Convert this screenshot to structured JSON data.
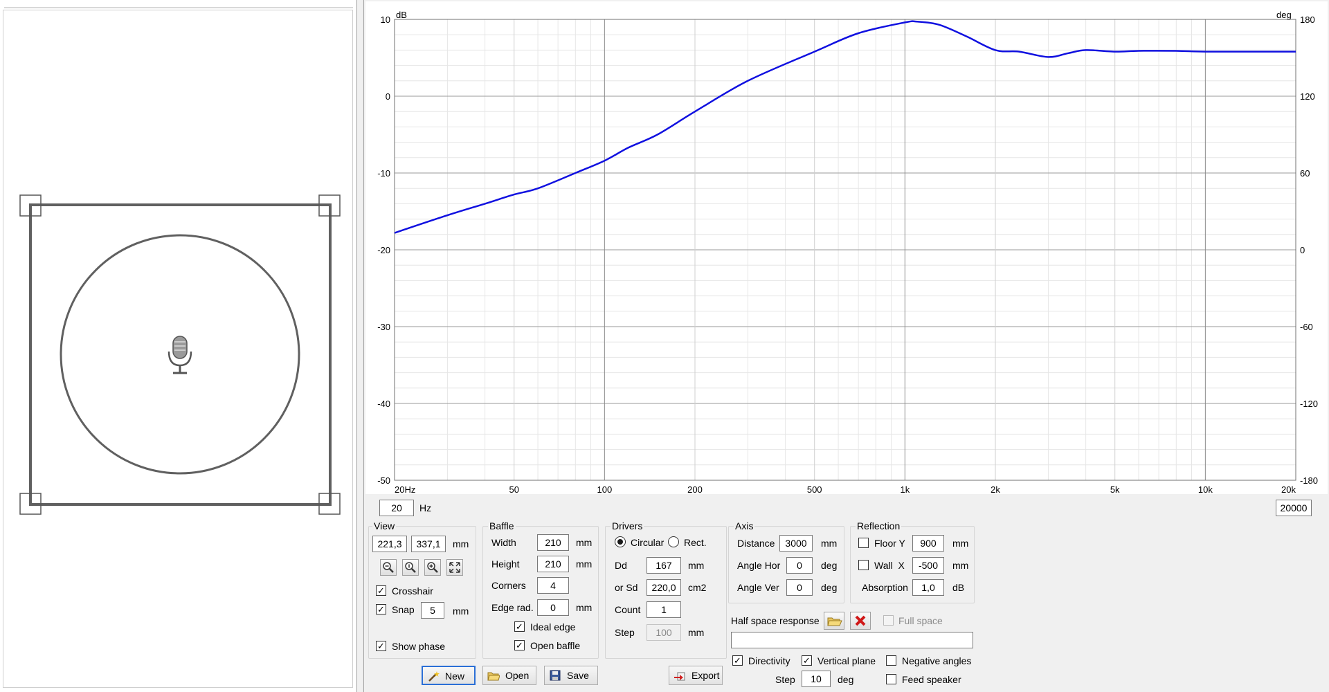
{
  "view": {
    "x_value": "221,3",
    "y_value": "337,1",
    "unit": "mm",
    "title": "View",
    "crosshair": {
      "label": "Crosshair",
      "checked": true
    },
    "snap": {
      "label": "Snap",
      "checked": true,
      "value": "5",
      "unit": "mm"
    },
    "show_phase": {
      "label": "Show phase",
      "checked": true
    }
  },
  "chart": {
    "y_left_unit": "dB",
    "y_right_unit": "deg",
    "y_left_ticks": [
      "10",
      "0",
      "-10",
      "-20",
      "-30",
      "-40",
      "-50"
    ],
    "y_right_ticks": [
      "180",
      "120",
      "60",
      "0",
      "-60",
      "-120",
      "-180"
    ],
    "x_ticks": [
      "20Hz",
      "50",
      "100",
      "200",
      "500",
      "1k",
      "2k",
      "5k",
      "10k",
      "20k"
    ],
    "freq_min": "20",
    "freq_unit": "Hz",
    "freq_max": "20000",
    "line_color": "#1010e0"
  },
  "chart_data": {
    "type": "line",
    "xscale": "log",
    "xlim": [
      20,
      20000
    ],
    "ylim": [
      -50,
      10
    ],
    "y2lim": [
      -180,
      180
    ],
    "series": [
      {
        "x": [
          20,
          30,
          40,
          50,
          60,
          80,
          100,
          120,
          150,
          200,
          300,
          500,
          700,
          1000,
          1100,
          1300,
          1600,
          2000,
          2400,
          3000,
          3500,
          4000,
          5000,
          6000,
          8000,
          10000,
          15000,
          20000
        ],
        "y": [
          -17.8,
          -15.5,
          -14.0,
          -12.8,
          -12.0,
          -10.0,
          -8.4,
          -6.7,
          -5.0,
          -2.0,
          2.0,
          5.8,
          8.2,
          9.6,
          9.7,
          9.3,
          7.8,
          6.0,
          5.8,
          5.1,
          5.6,
          6.0,
          5.8,
          5.9,
          5.9,
          5.8,
          5.8,
          5.8
        ]
      }
    ]
  },
  "baffle": {
    "title": "Baffle",
    "width_label": "Width",
    "width_value": "210",
    "width_unit": "mm",
    "height_label": "Height",
    "height_value": "210",
    "height_unit": "mm",
    "corners_label": "Corners",
    "corners_value": "4",
    "edge_label": "Edge rad.",
    "edge_value": "0",
    "edge_unit": "mm",
    "ideal_edge": {
      "label": "Ideal edge",
      "checked": true
    },
    "open_baffle": {
      "label": "Open baffle",
      "checked": true
    }
  },
  "drivers": {
    "title": "Drivers",
    "circular_label": "Circular",
    "rect_label": "Rect.",
    "dd_label": "Dd",
    "dd_value": "167",
    "dd_unit": "mm",
    "sd_label": "or Sd",
    "sd_value": "220,0",
    "sd_unit": "cm2",
    "count_label": "Count",
    "count_value": "1",
    "step_label": "Step",
    "step_value": "100",
    "step_unit": "mm"
  },
  "axis": {
    "title": "Axis",
    "distance_label": "Distance",
    "distance_value": "3000",
    "distance_unit": "mm",
    "angle_hor_label": "Angle Hor",
    "angle_hor_value": "0",
    "angle_hor_unit": "deg",
    "angle_ver_label": "Angle Ver",
    "angle_ver_value": "0",
    "angle_ver_unit": "deg"
  },
  "reflection": {
    "title": "Reflection",
    "floor_label": "Floor Y",
    "floor_value": "900",
    "floor_unit": "mm",
    "wall_label": "Wall  X",
    "wall_value": "-500",
    "wall_unit": "mm",
    "absorption_label": "Absorption",
    "absorption_value": "1,0",
    "absorption_unit": "dB"
  },
  "half_space": {
    "label": "Half space response",
    "full_space_label": "Full space",
    "path_value": ""
  },
  "options": {
    "directivity": "Directivity",
    "vertical_plane": "Vertical plane",
    "negative_angles": "Negative angles",
    "feed_speaker": "Feed speaker",
    "step_label": "Step",
    "step_value": "10",
    "step_unit": "deg"
  },
  "buttons": {
    "new": "New",
    "open": "Open",
    "save": "Save",
    "export": "Export"
  }
}
